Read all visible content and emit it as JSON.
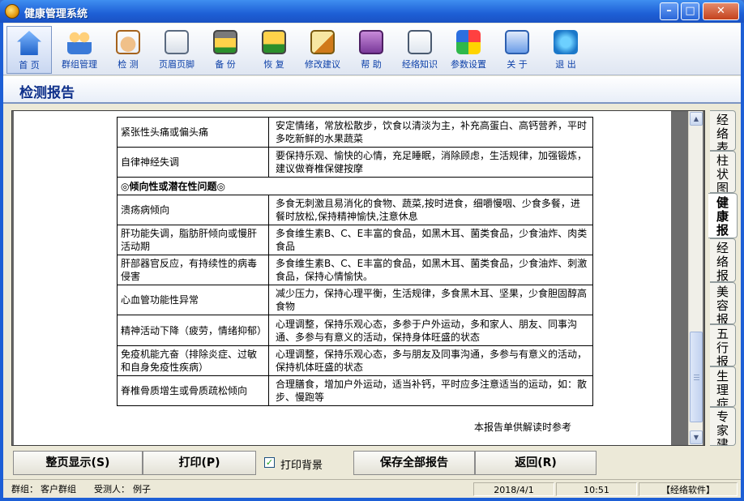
{
  "window": {
    "title": "健康管理系统"
  },
  "toolbar": [
    {
      "label": "首 页",
      "icon": "home-icon"
    },
    {
      "label": "群组管理",
      "icon": "group-icon"
    },
    {
      "label": "检 测",
      "icon": "hand-icon"
    },
    {
      "label": "页眉页脚",
      "icon": "page-icon"
    },
    {
      "label": "备 份",
      "icon": "backup-icon"
    },
    {
      "label": "恢 复",
      "icon": "restore-icon"
    },
    {
      "label": "修改建议",
      "icon": "edit-icon"
    },
    {
      "label": "帮 助",
      "icon": "help-icon"
    },
    {
      "label": "经络知识",
      "icon": "knowledge-icon"
    },
    {
      "label": "参数设置",
      "icon": "settings-icon"
    },
    {
      "label": "关 于",
      "icon": "about-icon"
    },
    {
      "label": "退 出",
      "icon": "exit-icon"
    }
  ],
  "section": {
    "title": "检测报告"
  },
  "report": {
    "rows": [
      {
        "type": "item",
        "name": "紧张性头痛或偏头痛",
        "advice": "安定情绪，常放松散步，饮食以清淡为主，补充高蛋白、高钙营养，平时多吃新鲜的水果蔬菜"
      },
      {
        "type": "item",
        "name": "自律神经失调",
        "advice": "要保持乐观、愉快的心情，充足睡眠，消除顾虑，生活规律，加强锻炼，建议做脊椎保健按摩"
      },
      {
        "type": "section",
        "name": "◎倾向性或潜在性问题◎"
      },
      {
        "type": "item",
        "name": "溃疡病倾向",
        "advice": "多食无刺激且易消化的食物、蔬菜,按时进食，细嚼慢咽、少食多餐，进餐时放松,保持精神愉快,注意休息"
      },
      {
        "type": "item",
        "name": "肝功能失调，脂肪肝倾向或慢肝活动期",
        "advice": "多食维生素B、C、E丰富的食品，如黑木耳、菌类食品，少食油炸、肉类食品"
      },
      {
        "type": "item",
        "name": "肝部器官反应，有持续性的病毒侵害",
        "advice": "多食维生素B、C、E丰富的食品，如黑木耳、菌类食品，少食油炸、刺激食品，保持心情愉快。"
      },
      {
        "type": "item",
        "name": "心血管功能性异常",
        "advice": "减少压力，保持心理平衡，生活规律，多食黑木耳、坚果，少食胆固醇高食物"
      },
      {
        "type": "item",
        "name": "精神活动下降（疲劳，情绪抑郁）",
        "advice": "心理调整，保持乐观心态，多参于户外运动，多和家人、朋友、同事沟通、多参与有意义的活动，保持身体旺盛的状态"
      },
      {
        "type": "item",
        "name": "免疫机能亢奋（排除炎症、过敏和自身免疫性疾病）",
        "advice": "心理调整，保持乐观心态，多与朋友及同事沟通，多参与有意义的活动，保持机体旺盛的状态"
      },
      {
        "type": "item",
        "name": "脊椎骨质增生或骨质疏松倾向",
        "advice": "合理膳食，增加户外运动，适当补钙，平时应多注意适当的运动，如：散步、慢跑等"
      }
    ],
    "footnote": "本报告单供解读时参考"
  },
  "side_tabs": [
    {
      "label": "经络表",
      "active": false
    },
    {
      "label": "柱状图",
      "active": false
    },
    {
      "label": "健康报告",
      "active": true
    },
    {
      "label": "经络报告",
      "active": false
    },
    {
      "label": "美容报告",
      "active": false
    },
    {
      "label": "五行报告",
      "active": false
    },
    {
      "label": "生理症状",
      "active": false
    },
    {
      "label": "专家建议",
      "active": false
    }
  ],
  "buttons": {
    "full_page": "整页显示(S)",
    "print": "打印(P)",
    "print_bg_label": "打印背景",
    "print_bg_checked": true,
    "save_all": "保存全部报告",
    "back": "返回(R)"
  },
  "status": {
    "group_label": "群组：",
    "group_value": "客户群组",
    "subject_label": "受测人：",
    "subject_value": "例子",
    "date": "2018/4/1",
    "time": "10:51",
    "vendor": "【经络软件】"
  }
}
